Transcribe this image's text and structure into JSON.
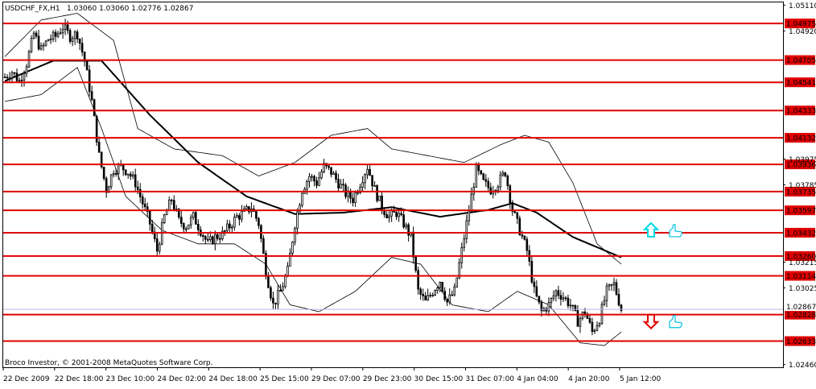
{
  "header": {
    "symbol": "USDCHF_FX,H1",
    "ohlc": "1.03060 1.03060 1.02776 1.02867"
  },
  "footer": {
    "copyright": "Broco Investor, © 2001-2008 MetaQuotes Software Corp."
  },
  "colors": {
    "candle": "#000000",
    "level_line": "#e00000",
    "level_label_bg": "#e00000",
    "level_label_text": "#ffffff",
    "moving_average": "#000000",
    "bands": "#000000",
    "current_price": "#b8b8e0",
    "up_arrow": "#00d8e8",
    "down_arrow": "#e00000",
    "thumbs": "#00c0e0"
  },
  "chart_data": {
    "type": "candlestick",
    "title": "USDCHF_FX,H1",
    "x_tick_labels": [
      "22 Dec 2009",
      "22 Dec 18:00",
      "23 Dec 10:00",
      "24 Dec 02:00",
      "24 Dec 18:00",
      "25 Dec 15:00",
      "29 Dec 07:00",
      "29 Dec 23:00",
      "30 Dec 15:00",
      "31 Dec 07:00",
      "4 Jan 04:00",
      "4 Jan 20:00",
      "5 Jan 12:00"
    ],
    "y_tick_labels": [
      "1.05110",
      "1.04920",
      "1.03975",
      "1.03785",
      "1.03215",
      "1.03025",
      "1.02460"
    ],
    "ylim": [
      1.0244,
      1.0513
    ],
    "levels": [
      1.04975,
      1.04705,
      1.04541,
      1.04333,
      1.04132,
      1.03936,
      1.03735,
      1.03597,
      1.03432,
      1.0326,
      1.03114,
      1.02828,
      1.02633
    ],
    "level_labels": [
      "1.04975",
      "1.04705",
      "1.04541",
      "1.04333",
      "1.04132",
      "1.03936",
      "1.03735",
      "1.03597",
      "1.03432",
      "1.03260",
      "1.03114",
      "1.02828",
      "1.02633"
    ],
    "current_price": 1.02867,
    "current_price_label": "1.02867",
    "signals": [
      {
        "type": "buy",
        "price": 1.0345,
        "icon": "up-arrow"
      },
      {
        "type": "sell",
        "price": 1.0278,
        "icon": "down-arrow"
      }
    ],
    "ohlc_anchors": [
      [
        0,
        1.0458
      ],
      [
        3,
        1.0462
      ],
      [
        6,
        1.0455
      ],
      [
        9,
        1.0468
      ],
      [
        12,
        1.049
      ],
      [
        15,
        1.0478
      ],
      [
        18,
        1.0486
      ],
      [
        21,
        1.0488
      ],
      [
        24,
        1.0495
      ],
      [
        27,
        1.0488
      ],
      [
        30,
        1.049
      ],
      [
        33,
        1.047
      ],
      [
        36,
        1.044
      ],
      [
        39,
        1.04
      ],
      [
        42,
        1.0375
      ],
      [
        45,
        1.039
      ],
      [
        48,
        1.0392
      ],
      [
        51,
        1.0388
      ],
      [
        54,
        1.038
      ],
      [
        57,
        1.0365
      ],
      [
        60,
        1.035
      ],
      [
        63,
        1.033
      ],
      [
        66,
        1.0355
      ],
      [
        69,
        1.0368
      ],
      [
        72,
        1.0352
      ],
      [
        75,
        1.0348
      ],
      [
        78,
        1.0355
      ],
      [
        81,
        1.0345
      ],
      [
        84,
        1.0335
      ],
      [
        87,
        1.034
      ],
      [
        90,
        1.0342
      ],
      [
        93,
        1.0348
      ],
      [
        96,
        1.0355
      ],
      [
        99,
        1.0358
      ],
      [
        102,
        1.0362
      ],
      [
        105,
        1.035
      ],
      [
        108,
        1.0315
      ],
      [
        111,
        1.029
      ],
      [
        114,
        1.03
      ],
      [
        117,
        1.0315
      ],
      [
        120,
        1.035
      ],
      [
        123,
        1.0375
      ],
      [
        126,
        1.0385
      ],
      [
        129,
        1.038
      ],
      [
        132,
        1.0392
      ],
      [
        135,
        1.0388
      ],
      [
        138,
        1.038
      ],
      [
        141,
        1.0372
      ],
      [
        144,
        1.0368
      ],
      [
        147,
        1.038
      ],
      [
        150,
        1.0392
      ],
      [
        153,
        1.0375
      ],
      [
        156,
        1.0362
      ],
      [
        159,
        1.0355
      ],
      [
        162,
        1.0358
      ],
      [
        165,
        1.035
      ],
      [
        168,
        1.034
      ],
      [
        171,
        1.03
      ],
      [
        174,
        1.0292
      ],
      [
        177,
        1.03
      ],
      [
        180,
        1.0308
      ],
      [
        183,
        1.0292
      ],
      [
        186,
        1.03
      ],
      [
        189,
        1.033
      ],
      [
        192,
        1.036
      ],
      [
        195,
        1.039
      ],
      [
        198,
        1.038
      ],
      [
        201,
        1.0375
      ],
      [
        204,
        1.038
      ],
      [
        207,
        1.0388
      ],
      [
        210,
        1.036
      ],
      [
        213,
        1.0345
      ],
      [
        216,
        1.033
      ],
      [
        219,
        1.03
      ],
      [
        222,
        1.0285
      ],
      [
        225,
        1.029
      ],
      [
        228,
        1.03
      ],
      [
        231,
        1.0296
      ],
      [
        234,
        1.029
      ],
      [
        237,
        1.0278
      ],
      [
        240,
        1.0285
      ],
      [
        243,
        1.027
      ],
      [
        246,
        1.028
      ],
      [
        249,
        1.03
      ],
      [
        252,
        1.0305
      ],
      [
        255,
        1.0287
      ]
    ],
    "bar_count": 256,
    "moving_average": [
      [
        0,
        1.0455
      ],
      [
        20,
        1.047
      ],
      [
        40,
        1.047
      ],
      [
        60,
        1.043
      ],
      [
        80,
        1.0395
      ],
      [
        100,
        1.037
      ],
      [
        120,
        1.0357
      ],
      [
        140,
        1.0358
      ],
      [
        160,
        1.0362
      ],
      [
        180,
        1.0355
      ],
      [
        200,
        1.036
      ],
      [
        210,
        1.0365
      ],
      [
        220,
        1.0358
      ],
      [
        235,
        1.034
      ],
      [
        255,
        1.0325
      ]
    ],
    "upper_band": [
      [
        0,
        1.0473
      ],
      [
        15,
        1.05
      ],
      [
        30,
        1.0505
      ],
      [
        45,
        1.0485
      ],
      [
        55,
        1.042
      ],
      [
        70,
        1.0405
      ],
      [
        90,
        1.04
      ],
      [
        105,
        1.0385
      ],
      [
        120,
        1.0395
      ],
      [
        135,
        1.0415
      ],
      [
        150,
        1.042
      ],
      [
        160,
        1.0405
      ],
      [
        175,
        1.04
      ],
      [
        190,
        1.0395
      ],
      [
        205,
        1.0408
      ],
      [
        215,
        1.0415
      ],
      [
        225,
        1.041
      ],
      [
        235,
        1.038
      ],
      [
        245,
        1.0335
      ],
      [
        255,
        1.032
      ]
    ],
    "lower_band": [
      [
        0,
        1.044
      ],
      [
        15,
        1.0445
      ],
      [
        30,
        1.0465
      ],
      [
        40,
        1.042
      ],
      [
        50,
        1.037
      ],
      [
        65,
        1.0345
      ],
      [
        80,
        1.0335
      ],
      [
        95,
        1.0335
      ],
      [
        108,
        1.032
      ],
      [
        118,
        1.029
      ],
      [
        130,
        1.0285
      ],
      [
        145,
        1.03
      ],
      [
        160,
        1.0325
      ],
      [
        172,
        1.032
      ],
      [
        185,
        1.029
      ],
      [
        200,
        1.0285
      ],
      [
        212,
        1.03
      ],
      [
        225,
        1.029
      ],
      [
        238,
        1.0262
      ],
      [
        248,
        1.026
      ],
      [
        255,
        1.027
      ]
    ]
  }
}
